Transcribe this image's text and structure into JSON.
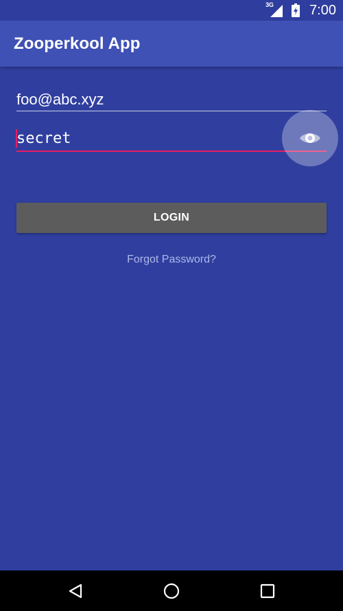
{
  "status_bar": {
    "network_type": "3G",
    "time": "7:00",
    "icons": [
      "signal-icon",
      "battery-icon"
    ]
  },
  "app_bar": {
    "title": "Zooperkool App"
  },
  "form": {
    "email_value": "foo@abc.xyz",
    "password_value": "secret",
    "login_label": "LOGIN",
    "forgot_password_label": "Forgot Password?"
  },
  "nav_bar": {
    "icons": [
      "back-icon",
      "home-icon",
      "recents-icon"
    ]
  },
  "colors": {
    "background": "#303F9F",
    "app_bar": "#3F51B5",
    "accent": "#E91E63",
    "button": "#5C5C5C",
    "link": "#AEB8E9"
  }
}
